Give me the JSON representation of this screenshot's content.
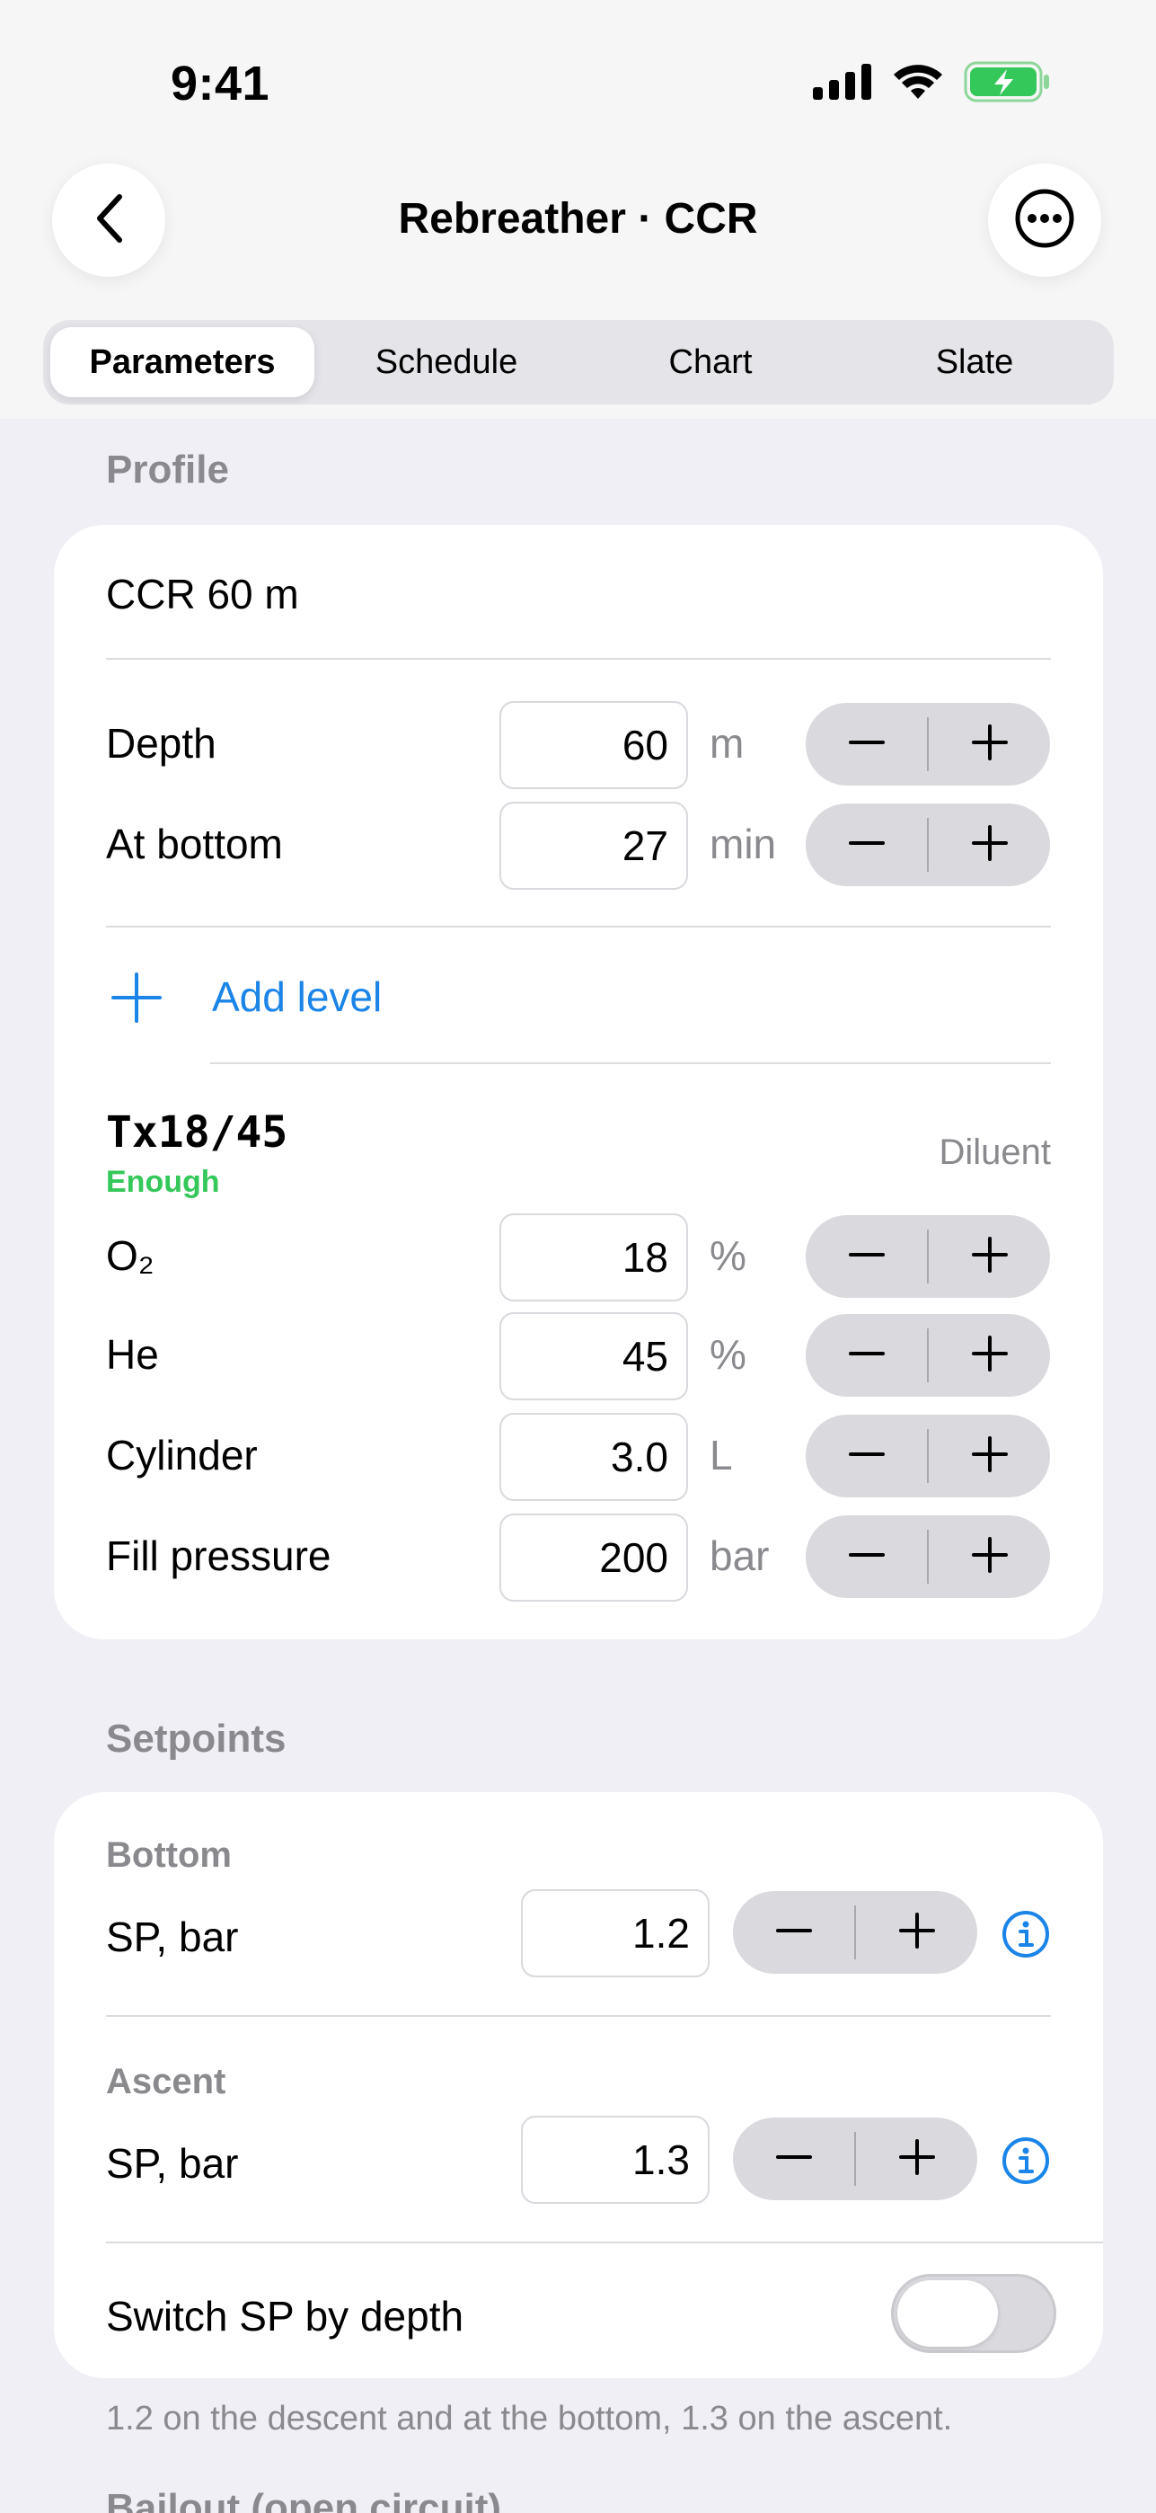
{
  "status": {
    "time": "9:41"
  },
  "nav": {
    "title": "Rebreather · CCR"
  },
  "tabs": [
    "Parameters",
    "Schedule",
    "Chart",
    "Slate"
  ],
  "profile": {
    "section_title": "Profile",
    "name": "CCR 60 m",
    "depth": {
      "label": "Depth",
      "value": "60",
      "unit": "m"
    },
    "bottom": {
      "label": "At bottom",
      "value": "27",
      "unit": "min"
    },
    "add_level": "Add level",
    "gas": {
      "name": "Tx18/45",
      "status": "Enough",
      "role": "Diluent",
      "o2": {
        "label": "O₂",
        "value": "18",
        "unit": "%"
      },
      "he": {
        "label": "He",
        "value": "45",
        "unit": "%"
      },
      "cylinder": {
        "label": "Cylinder",
        "value": "3.0",
        "unit": "L"
      },
      "fill": {
        "label": "Fill pressure",
        "value": "200",
        "unit": "bar"
      }
    }
  },
  "setpoints": {
    "section_title": "Setpoints",
    "bottom": {
      "title": "Bottom",
      "label": "SP, bar",
      "value": "1.2"
    },
    "ascent": {
      "title": "Ascent",
      "label": "SP, bar",
      "value": "1.3"
    },
    "switch_label": "Switch SP by depth",
    "switch_on": false,
    "footnote": "1.2 on the descent and at the bottom, 1.3 on the ascent."
  },
  "next_section": "Bailout (open circuit)",
  "colors": {
    "accent": "#1a84e8",
    "ok": "#34c759",
    "background": "#f0eff5"
  }
}
